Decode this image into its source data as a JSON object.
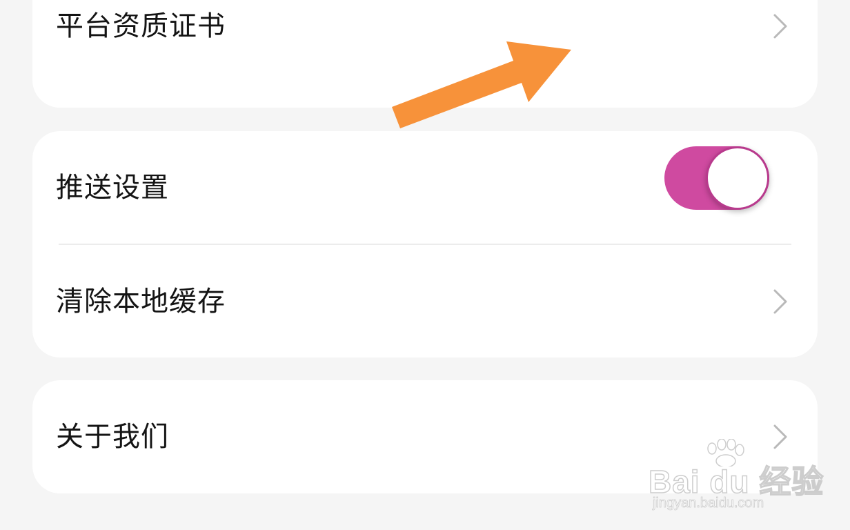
{
  "settings": {
    "cards": [
      {
        "items": [
          {
            "label": "平台资质证书",
            "has_chevron": true
          }
        ]
      },
      {
        "items": [
          {
            "label": "推送设置",
            "toggle": {
              "state": "on",
              "color": "#cf4aa0"
            }
          },
          {
            "label": "清除本地缓存",
            "has_chevron": true
          }
        ]
      },
      {
        "items": [
          {
            "label": "关于我们",
            "has_chevron": true
          }
        ]
      }
    ]
  },
  "annotation": {
    "arrow_color": "#f7923a",
    "arrow_icon": "arrow-right-up-icon"
  },
  "watermark": {
    "logo_text": "Bai du 经验",
    "url": "jingyan.baidu.com"
  }
}
